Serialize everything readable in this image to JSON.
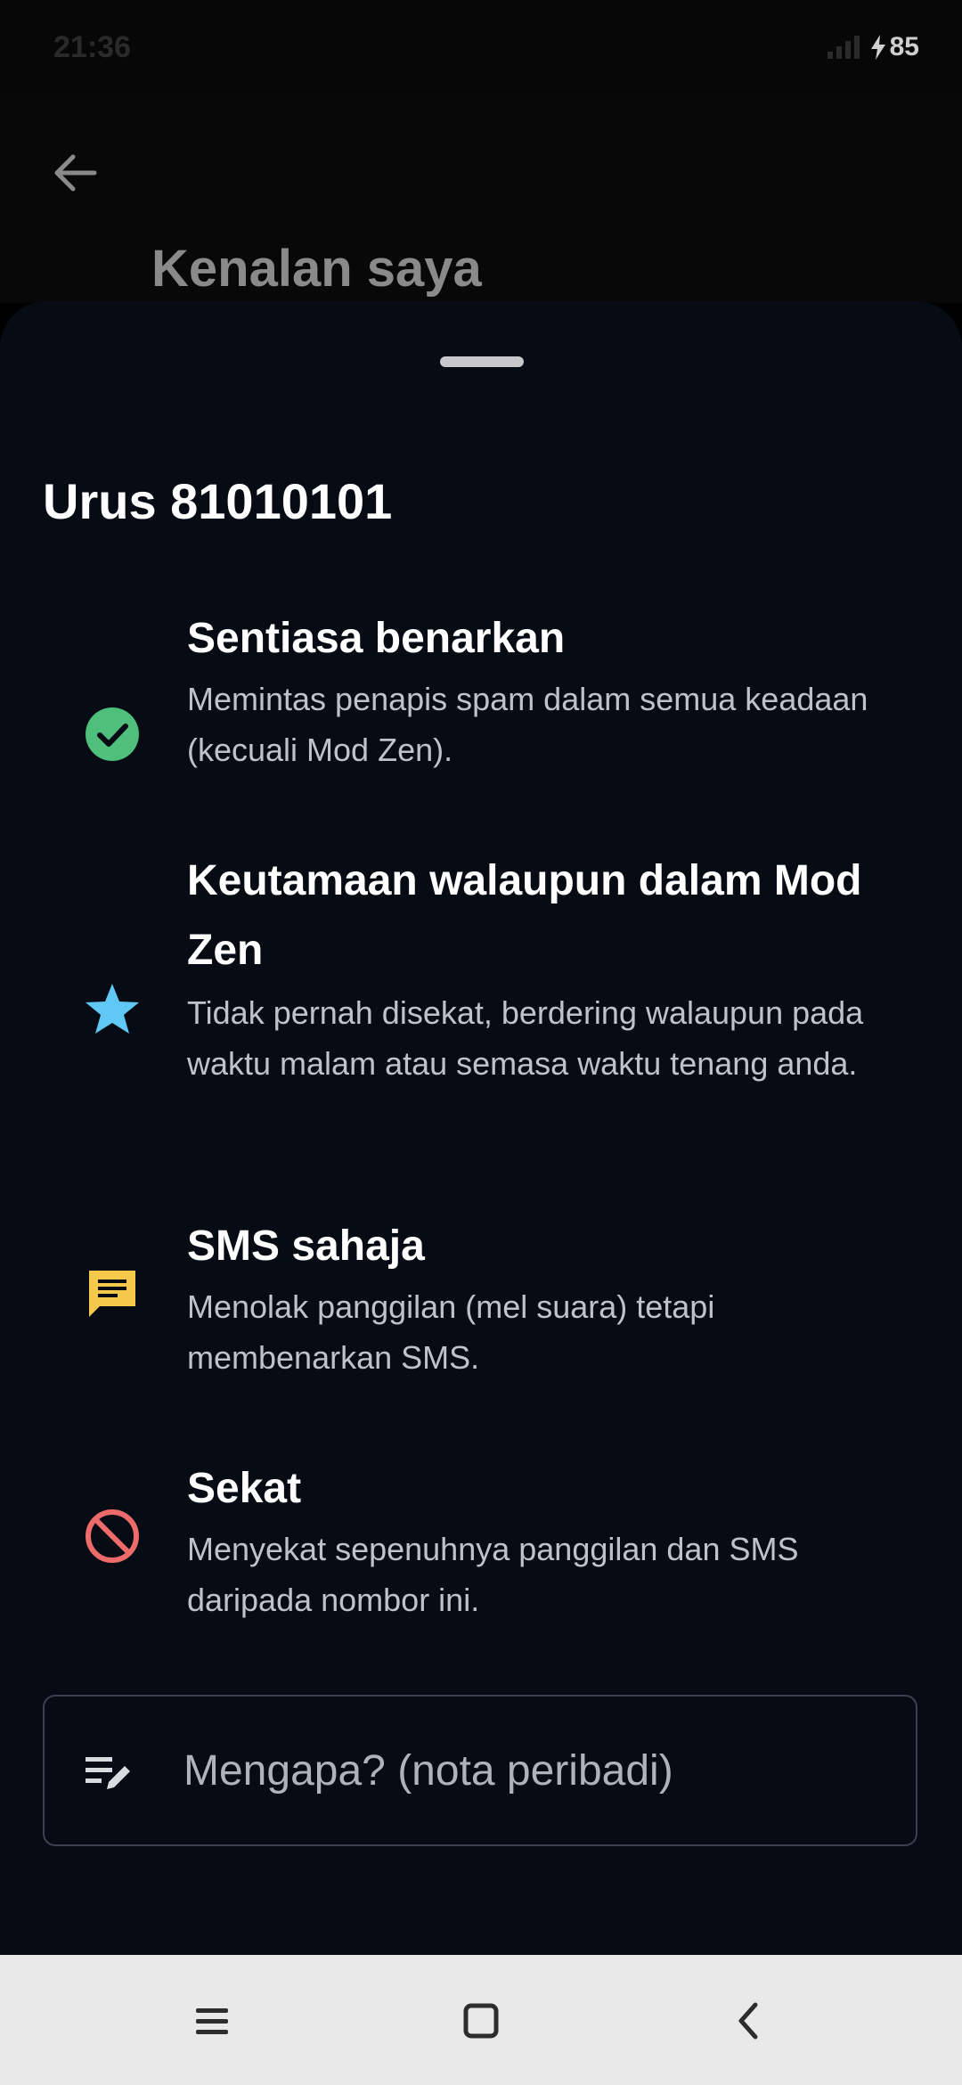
{
  "status": {
    "time": "21:36",
    "battery": "85"
  },
  "appbar": {
    "title": "Kenalan saya"
  },
  "sheet": {
    "title": "Urus 81010101",
    "options": [
      {
        "title": "Sentiasa benarkan",
        "desc": "Memintas penapis spam dalam semua keadaan (kecuali Mod Zen).",
        "icon": "check-circle-icon",
        "color": "#4fc07b"
      },
      {
        "title": "Keutamaan walaupun dalam Mod Zen",
        "desc": "Tidak pernah disekat, berdering walaupun pada waktu malam atau semasa waktu tenang anda.",
        "icon": "star-icon",
        "color": "#5fc8f5"
      },
      {
        "title": "SMS sahaja",
        "desc": "Menolak panggilan (mel suara) tetapi membenarkan SMS.",
        "icon": "message-icon",
        "color": "#f4c84a"
      },
      {
        "title": "Sekat",
        "desc": "Menyekat sepenuhnya panggilan dan SMS daripada nombor ini.",
        "icon": "block-icon",
        "color": "#ee6b6b"
      }
    ],
    "note": {
      "placeholder": "Mengapa? (nota peribadi)"
    }
  }
}
